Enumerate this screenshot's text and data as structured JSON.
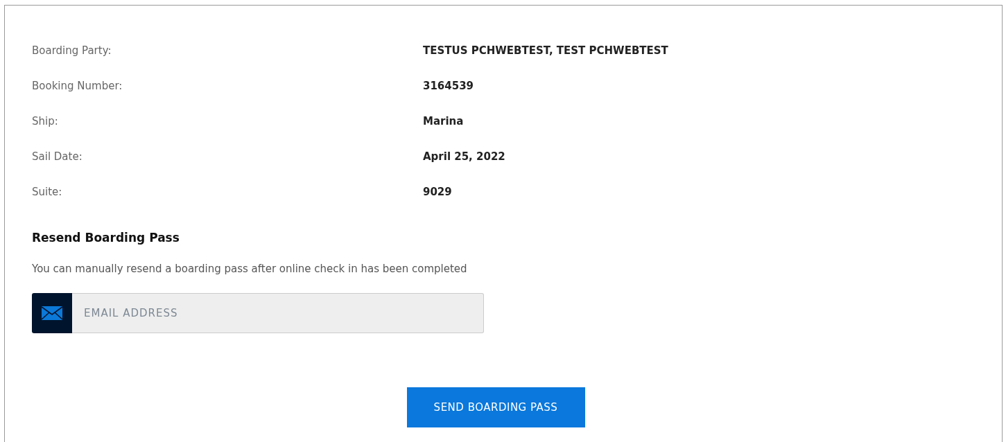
{
  "details": [
    {
      "label": "Boarding Party:",
      "value": "TESTUS PCHWEBTEST, TEST PCHWEBTEST"
    },
    {
      "label": "Booking Number:",
      "value": "3164539"
    },
    {
      "label": "Ship:",
      "value": "Marina"
    },
    {
      "label": "Sail Date:",
      "value": "April 25, 2022"
    },
    {
      "label": "Suite:",
      "value": "9029"
    }
  ],
  "resend": {
    "title": "Resend Boarding Pass",
    "description": "You can manually resend a boarding pass after online check in has been completed",
    "email": {
      "placeholder": "EMAIL ADDRESS"
    },
    "button": "SEND BOARDING PASS"
  }
}
